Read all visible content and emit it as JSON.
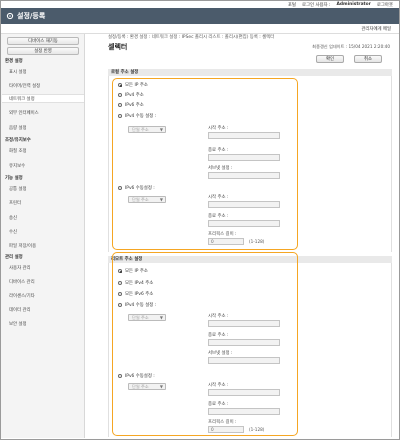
{
  "top_links": [
    "포털",
    "로그인 사용자 :",
    "Administrator",
    "로그아웃"
  ],
  "header": {
    "title": "설정/등록"
  },
  "subbar": {
    "manager_mail": "관리자에게 메일"
  },
  "sidebar": {
    "device_reboot": "디바이스 재기동",
    "apply_settings": "설정 반영",
    "groups": [
      {
        "label": "환경 설정",
        "items": [
          "표시 설정",
          "타이머/전력 설정",
          "네트워크 설정",
          "외부 인터페이스",
          "음량 설정"
        ]
      },
      {
        "label": "조정/유지보수",
        "items": [
          "화질 조정",
          "유지보수"
        ]
      },
      {
        "label": "기능 설정",
        "items": [
          "공통 설정",
          "프린터",
          "송신",
          "수신",
          "파일 저장/이용"
        ]
      },
      {
        "label": "관리 설정",
        "items": [
          "사용자 관리",
          "디바이스 관리",
          "라이센스/기타",
          "데이터 관리",
          "보안 설정"
        ]
      }
    ],
    "active_item": "네트워크 설정"
  },
  "breadcrumb": "설정/등록 : 환경 설정 : 네트워크 설정 : IPSec 폴리시 리스트 : 폴리시(편집) 등록 : 셀렉터",
  "page_title": "셀렉터",
  "last_updated": "최종갱신 업데이트 : 15/04 2021 2:20:40",
  "buttons": {
    "ok": "확인",
    "cancel": "취소"
  },
  "local": {
    "title": "로컬 주소 설정",
    "options": [
      "모든 IP 주소",
      "IPv4 주소",
      "IPv6 주소",
      "IPv4 수동 설정 :",
      "IPv6 수동설정 :"
    ],
    "selected": 0
  },
  "remote": {
    "title": "리모트 주소 설정",
    "options": [
      "모든 IP 주소",
      "모든 IPv4 주소",
      "모든 IPv6 주소",
      "IPv4 수동 설정 :",
      "IPv6 수동설정 :"
    ],
    "selected": 0
  },
  "manual": {
    "select_value": "단일 주소",
    "start": "시작 주소 :",
    "end": "종료 주소 :",
    "subnet": "서브넷 설정 :",
    "prefix": "프리픽스 길이 :",
    "prefix_value": "0",
    "prefix_range": "(1-128)"
  }
}
